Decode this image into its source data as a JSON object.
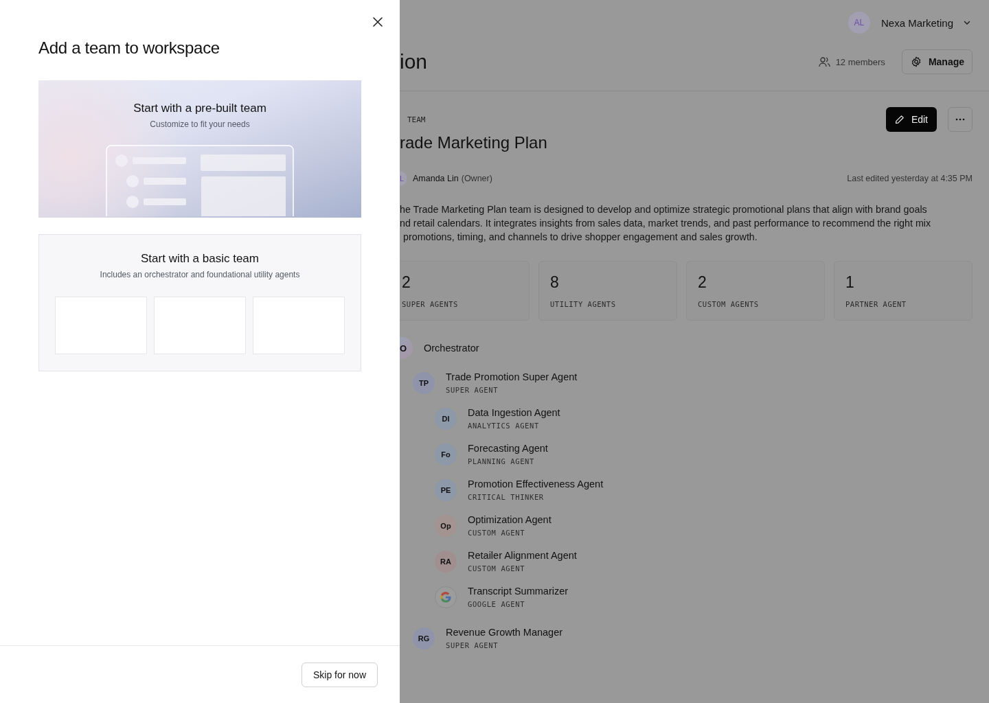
{
  "drawer": {
    "title": "Add a team to workspace",
    "options": [
      {
        "kind": "prebuilt",
        "title": "Start with a pre-built team",
        "subtitle": "Customize to fit your needs"
      },
      {
        "kind": "basic",
        "title": "Start with a basic team",
        "subtitle": "Includes an orchestrator and foundational utility agents"
      }
    ],
    "skip_button": "Skip for now"
  },
  "topbar": {
    "avatar": "AL",
    "workspace": "Nexa Marketing"
  },
  "header": {
    "title": "ion",
    "members": "12 members",
    "manage_button": "Manage"
  },
  "team": {
    "tag": "TEAM",
    "edit_button": "Edit",
    "title": "rade Marketing Plan",
    "owner_avatar": "L",
    "owner_name": "Amanda Lin",
    "owner_role": "(Owner)",
    "last_edited": "Last edited yesterday at 4:35 PM",
    "description_lines": [
      "he Trade Marketing Plan team is designed to develop and optimize strategic promotional plans that align with brand goals",
      "nd retail calendars. It integrates insights from sales data, market trends, and past performance to recommend the right mix",
      "promotions, timing, and channels to drive shopper engagement and sales growth."
    ],
    "stats": [
      {
        "value": "2",
        "label": "SUPER AGENTS"
      },
      {
        "value": "8",
        "label": "UTILITY AGENTS"
      },
      {
        "value": "2",
        "label": "CUSTOM AGENTS"
      },
      {
        "value": "1",
        "label": "PARTNER AGENT"
      }
    ]
  },
  "orchestrator": {
    "initials": "O",
    "name": "Orchestrator",
    "children": [
      {
        "kind": "initials",
        "initials": "TP",
        "color": "#8f94aa",
        "name": "Trade Promotion Super Agent",
        "role": "SUPER AGENT",
        "children": [
          {
            "kind": "initials",
            "initials": "DI",
            "color": "#8d98a8",
            "name": "Data Ingestion Agent",
            "role": "ANALYTICS AGENT"
          },
          {
            "kind": "initials",
            "initials": "Fo",
            "color": "#8d98a8",
            "name": "Forecasting Agent",
            "role": "PLANNING AGENT"
          },
          {
            "kind": "initials",
            "initials": "PE",
            "color": "#8d98a8",
            "name": "Promotion Effectiveness Agent",
            "role": "CRITICAL THINKER"
          },
          {
            "kind": "initials",
            "initials": "Op",
            "color": "#a39391",
            "name": "Optimization Agent",
            "role": "CUSTOM AGENT"
          },
          {
            "kind": "initials",
            "initials": "RA",
            "color": "#a18f90",
            "name": "Retailer Alignment Agent",
            "role": "CUSTOM AGENT"
          },
          {
            "kind": "google",
            "name": "Transcript Summarizer",
            "role": "GOOGLE AGENT"
          }
        ]
      },
      {
        "kind": "initials",
        "initials": "RG",
        "color": "#8f94aa",
        "name": "Revenue Growth Manager",
        "role": "SUPER AGENT"
      }
    ]
  }
}
